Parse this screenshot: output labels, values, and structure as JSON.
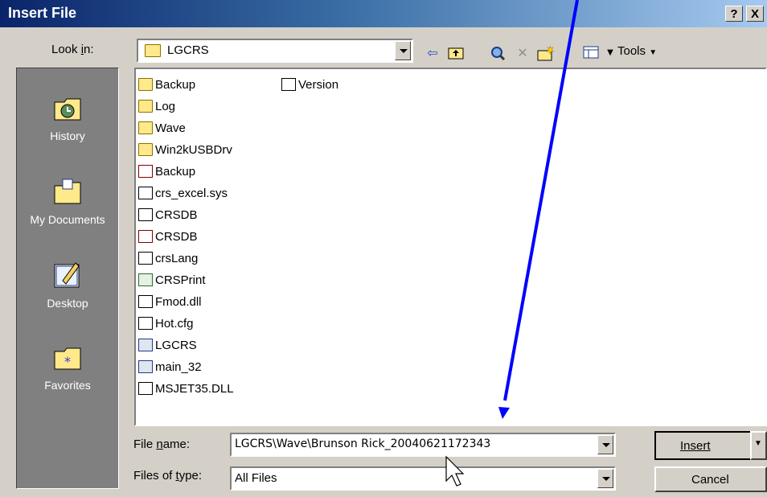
{
  "title": "Insert File",
  "titlebar": {
    "help_label": "?",
    "close_label": "X"
  },
  "toolbar": {
    "look_in_label": "Look in:",
    "look_in_value": "LGCRS",
    "tools_label": "Tools"
  },
  "places": [
    {
      "label": "History",
      "icon": "history-icon"
    },
    {
      "label": "My Documents",
      "icon": "my-documents-icon"
    },
    {
      "label": "Desktop",
      "icon": "desktop-icon"
    },
    {
      "label": "Favorites",
      "icon": "favorites-icon"
    }
  ],
  "files": [
    {
      "name": "Backup",
      "icon": "folder-icon"
    },
    {
      "name": "Log",
      "icon": "folder-icon"
    },
    {
      "name": "Wave",
      "icon": "folder-icon"
    },
    {
      "name": "Win2kUSBDrv",
      "icon": "folder-icon"
    },
    {
      "name": "Backup",
      "icon": "access-db-icon"
    },
    {
      "name": "crs_excel.sys",
      "icon": "system-file-icon"
    },
    {
      "name": "CRSDB",
      "icon": "data-file-icon"
    },
    {
      "name": "CRSDB",
      "icon": "access-db-icon"
    },
    {
      "name": "crsLang",
      "icon": "text-file-icon"
    },
    {
      "name": "CRSPrint",
      "icon": "setup-icon"
    },
    {
      "name": "Fmod.dll",
      "icon": "system-file-icon"
    },
    {
      "name": "Hot.cfg",
      "icon": "data-file-icon"
    },
    {
      "name": "LGCRS",
      "icon": "application-icon"
    },
    {
      "name": "main_32",
      "icon": "application-icon"
    },
    {
      "name": "MSJET35.DLL",
      "icon": "system-file-icon"
    },
    {
      "name": "Version",
      "icon": "text-file-icon"
    }
  ],
  "form": {
    "filename_label": "File name:",
    "filename_value": "LGCRS\\Wave\\Brunson Rick_20040621172343",
    "filetype_label": "Files of type:",
    "filetype_value": "All Files"
  },
  "buttons": {
    "insert": "Insert",
    "cancel": "Cancel"
  },
  "colors": {
    "annotation_arrow": "#0000ff",
    "titlebar_start": "#0a246a",
    "places_bar": "#808080"
  }
}
